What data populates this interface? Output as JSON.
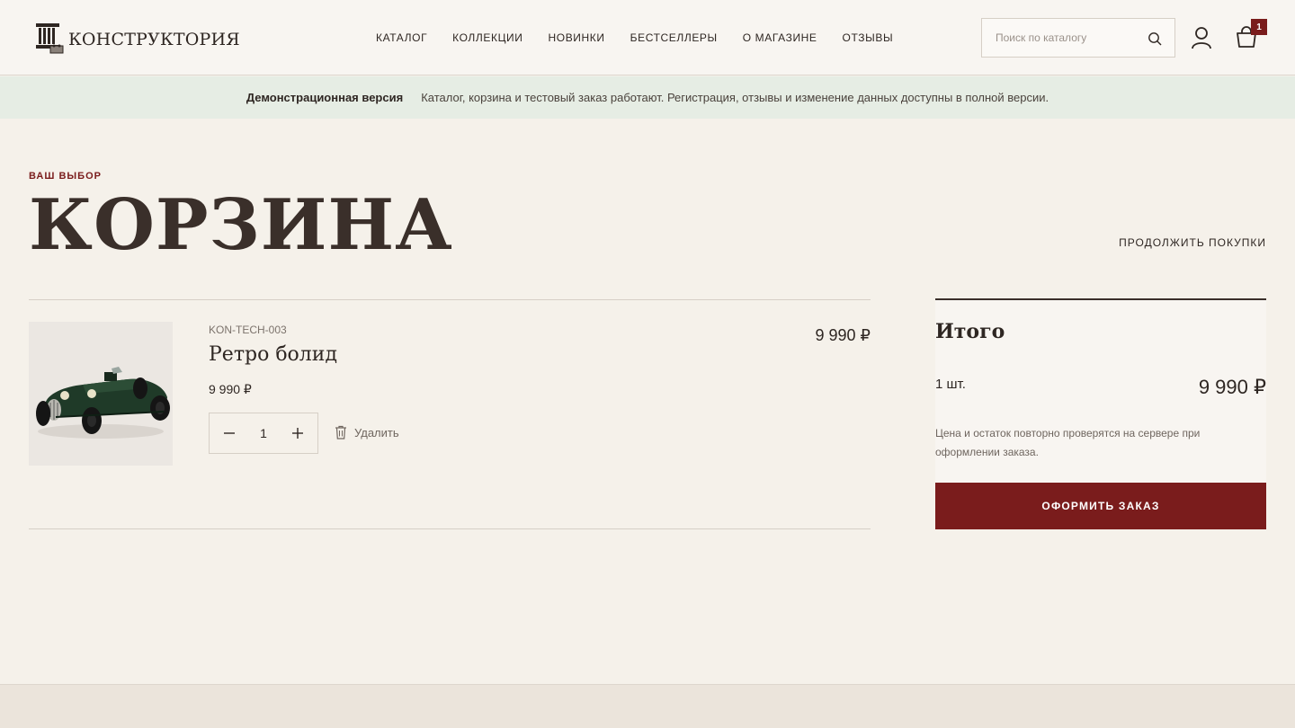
{
  "header": {
    "logo_text": "КОНСТРУКТОРИЯ",
    "nav": [
      "КАТАЛОГ",
      "КОЛЛЕКЦИИ",
      "НОВИНКИ",
      "БЕСТСЕЛЛЕРЫ",
      "О МАГАЗИНЕ",
      "ОТЗЫВЫ"
    ],
    "search_placeholder": "Поиск по каталогу",
    "cart_count": "1",
    "icons": {
      "search": "search-icon",
      "user": "user-icon",
      "cart": "shopping-bag-icon"
    }
  },
  "banner": {
    "title": "Демонстрационная версия",
    "text": "Каталог, корзина и тестовый заказ работают. Регистрация, отзывы и изменение данных доступны в полной версии."
  },
  "page": {
    "eyebrow": "ВАШ ВЫБОР",
    "title": "КОРЗИНА",
    "continue_label": "ПРОДОЛЖИТЬ ПОКУПКИ"
  },
  "cart": {
    "items": [
      {
        "sku": "KON-TECH-003",
        "name": "Ретро болид",
        "unit_price": "9 990 ₽",
        "quantity": "1",
        "line_total": "9 990 ₽",
        "remove_label": "Удалить"
      }
    ]
  },
  "summary": {
    "title": "Итого",
    "count": "1 шт.",
    "total": "9 990 ₽",
    "note": "Цена и остаток повторно проверятся на сервере при оформлении заказа.",
    "checkout_label": "ОФОРМИТЬ ЗАКАЗ"
  },
  "colors": {
    "accent": "#7a1c1c",
    "background": "#f5f1ea",
    "banner_bg": "#e6ede4",
    "text": "#2e2622"
  }
}
